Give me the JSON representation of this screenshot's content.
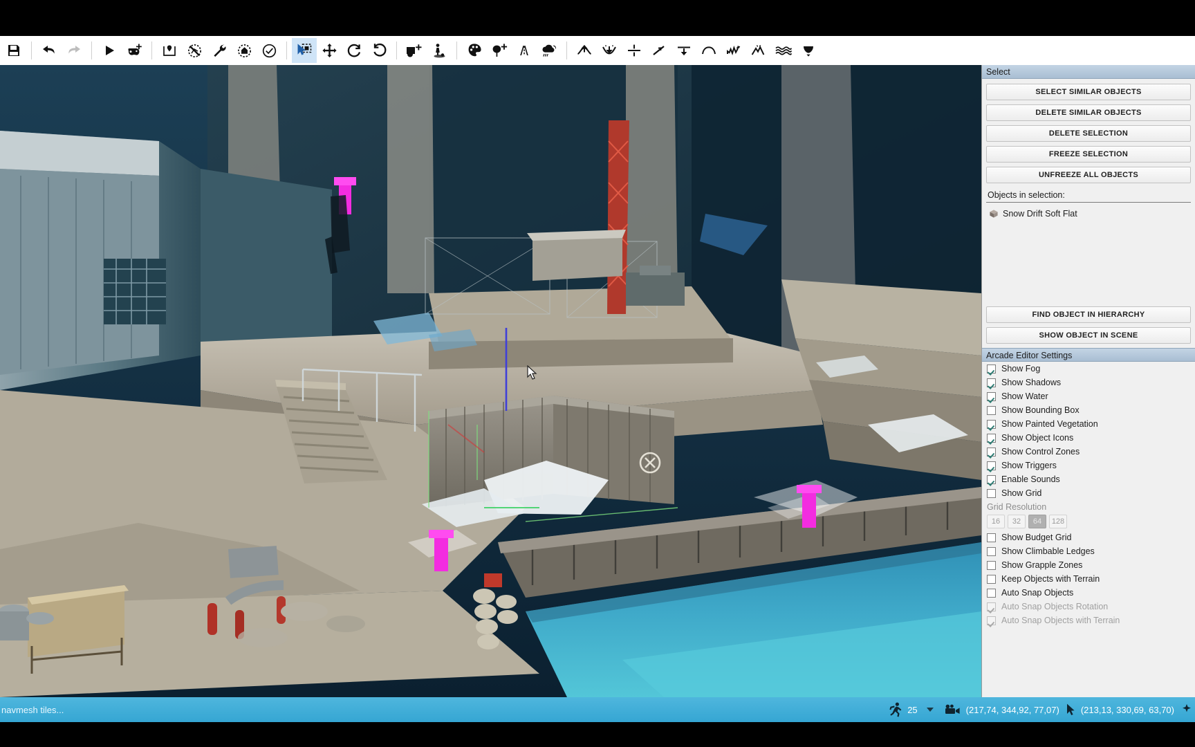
{
  "toolbar": {
    "groups": [
      {
        "items": [
          {
            "name": "save-icon",
            "label": "Save",
            "state": "normal"
          }
        ]
      },
      {
        "items": [
          {
            "name": "undo-icon",
            "label": "Undo",
            "state": "normal"
          },
          {
            "name": "redo-icon",
            "label": "Redo",
            "state": "disabled"
          }
        ]
      },
      {
        "items": [
          {
            "name": "play-icon",
            "label": "Play",
            "state": "normal"
          },
          {
            "name": "add-gamepad-icon",
            "label": "Add Player Start",
            "state": "normal"
          }
        ]
      },
      {
        "items": [
          {
            "name": "spawn-point-icon",
            "label": "Spawn Point",
            "state": "normal"
          },
          {
            "name": "no-navmesh-icon",
            "label": "Toggle Navmesh",
            "state": "normal"
          },
          {
            "name": "wrench-icon",
            "label": "Tools",
            "state": "normal"
          },
          {
            "name": "home-target-icon",
            "label": "Home Zone",
            "state": "normal"
          },
          {
            "name": "check-circle-icon",
            "label": "Validate",
            "state": "normal"
          }
        ]
      },
      {
        "items": [
          {
            "name": "select-tool-icon",
            "label": "Select",
            "state": "active"
          },
          {
            "name": "move-tool-icon",
            "label": "Move",
            "state": "normal"
          },
          {
            "name": "rotate-tool-icon",
            "label": "Rotate",
            "state": "normal"
          },
          {
            "name": "rotate-snap-tool-icon",
            "label": "Rotate Snap",
            "state": "normal"
          }
        ]
      },
      {
        "items": [
          {
            "name": "place-object-icon",
            "label": "Place Object",
            "state": "normal"
          },
          {
            "name": "place-character-icon",
            "label": "Place Character",
            "state": "normal"
          }
        ]
      },
      {
        "items": [
          {
            "name": "paint-palette-icon",
            "label": "Paint",
            "state": "normal"
          },
          {
            "name": "add-vegetation-icon",
            "label": "Add Vegetation",
            "state": "normal"
          },
          {
            "name": "road-icon",
            "label": "Road",
            "state": "normal"
          },
          {
            "name": "weather-icon",
            "label": "Weather",
            "state": "normal"
          }
        ]
      },
      {
        "items": [
          {
            "name": "terrain-raise-icon",
            "label": "Raise Terrain",
            "state": "normal"
          },
          {
            "name": "terrain-lower-icon",
            "label": "Lower Terrain",
            "state": "normal"
          },
          {
            "name": "terrain-flatten-icon",
            "label": "Flatten Terrain",
            "state": "normal"
          },
          {
            "name": "terrain-smooth-icon",
            "label": "Smooth Terrain",
            "state": "normal"
          },
          {
            "name": "terrain-plateau-icon",
            "label": "Plateau",
            "state": "normal"
          },
          {
            "name": "terrain-hill-icon",
            "label": "Hill",
            "state": "normal"
          },
          {
            "name": "terrain-noise-icon",
            "label": "Noise",
            "state": "normal"
          },
          {
            "name": "terrain-ridge-icon",
            "label": "Ridge",
            "state": "normal"
          },
          {
            "name": "terrain-water-icon",
            "label": "Water Level",
            "state": "normal"
          },
          {
            "name": "terrain-erode-icon",
            "label": "Erode",
            "state": "normal"
          }
        ]
      }
    ]
  },
  "select_panel": {
    "title": "Select",
    "buttons": [
      "SELECT SIMILAR OBJECTS",
      "DELETE SIMILAR OBJECTS",
      "DELETE SELECTION",
      "FREEZE SELECTION",
      "UNFREEZE ALL OBJECTS"
    ],
    "objects_label": "Objects in selection:",
    "objects": [
      {
        "name": "Snow Drift Soft Flat",
        "icon": "cube-icon"
      }
    ],
    "footer_buttons": [
      "FIND OBJECT IN HIERARCHY",
      "SHOW OBJECT IN SCENE"
    ]
  },
  "settings_panel": {
    "title": "Arcade Editor Settings",
    "items": [
      {
        "label": "Show Fog",
        "checked": true,
        "disabled": false
      },
      {
        "label": "Show Shadows",
        "checked": true,
        "disabled": false
      },
      {
        "label": "Show Water",
        "checked": true,
        "disabled": false
      },
      {
        "label": "Show Bounding Box",
        "checked": false,
        "disabled": false
      },
      {
        "label": "Show Painted Vegetation",
        "checked": true,
        "disabled": false
      },
      {
        "label": "Show Object Icons",
        "checked": true,
        "disabled": false
      },
      {
        "label": "Show Control Zones",
        "checked": true,
        "disabled": false
      },
      {
        "label": "Show Triggers",
        "checked": true,
        "disabled": false
      },
      {
        "label": "Enable Sounds",
        "checked": true,
        "disabled": false
      },
      {
        "label": "Show Grid",
        "checked": false,
        "disabled": false
      }
    ],
    "grid_resolution_label": "Grid Resolution",
    "grid_resolution_options": [
      "16",
      "32",
      "64",
      "128"
    ],
    "grid_resolution_selected": "64",
    "items_after_grid": [
      {
        "label": "Show Budget Grid",
        "checked": false,
        "disabled": false
      },
      {
        "label": "Show Climbable Ledges",
        "checked": false,
        "disabled": false
      },
      {
        "label": "Show Grapple Zones",
        "checked": false,
        "disabled": false
      },
      {
        "label": "Keep Objects with Terrain",
        "checked": false,
        "disabled": false
      },
      {
        "label": "Auto Snap Objects",
        "checked": false,
        "disabled": false
      },
      {
        "label": "Auto Snap Objects Rotation",
        "checked": true,
        "disabled": true
      },
      {
        "label": "Auto Snap Objects with Terrain",
        "checked": true,
        "disabled": true
      }
    ]
  },
  "statusbar": {
    "left_text": "navmesh tiles...",
    "walk_speed": "25",
    "camera_coords": "(217,74, 344,92, 77,07)",
    "cursor_coords": "(213,13, 330,69, 63,70)",
    "walk_icon": "running-man-icon",
    "camera_icon": "camera-icon",
    "cursor_icon": "mouse-cursor-icon",
    "dropdown_icon": "chevron-down-icon"
  },
  "colors": {
    "accent": "#35a6d3",
    "panel_bg": "#f0f0f0",
    "panel_header": "#a9bed3",
    "toolbar_active": "#cfe4f7",
    "gizmo_magenta": "#ff3df0",
    "check": "#2e7d74"
  }
}
